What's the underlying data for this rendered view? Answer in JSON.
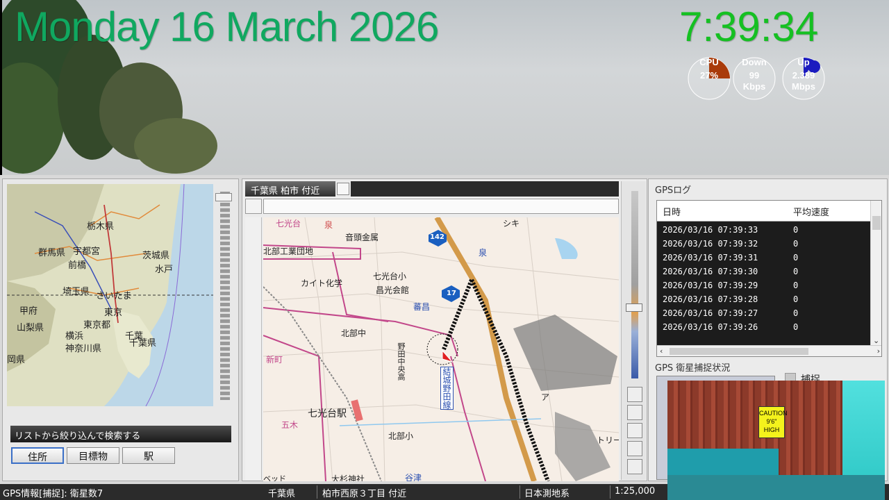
{
  "overlay": {
    "date": "Monday 16 March 2026",
    "time": "7:39:34",
    "gauges": [
      {
        "label": "CPU",
        "value": "27%",
        "unit": "",
        "percent": 27,
        "color": "#a93b0a"
      },
      {
        "label": "Down",
        "value": "99",
        "unit": "Kbps",
        "percent": 2,
        "color": "#2a44c4"
      },
      {
        "label": "Up",
        "value": "2.389",
        "unit": "Mbps",
        "percent": 8,
        "color": "#1b1bbf"
      }
    ]
  },
  "overview_map": {
    "labels": [
      "栃木県",
      "群馬県",
      "宇都宮",
      "前橋",
      "茨城県",
      "水戸",
      "埼玉県",
      "さいたま",
      "甲府",
      "東京",
      "山梨県",
      "東京都",
      "横浜",
      "千葉",
      "神奈川県",
      "千葉県",
      "岡県"
    ]
  },
  "search": {
    "header": "リストから絞り込んで検索する",
    "buttons": [
      "住所",
      "目標物",
      "駅"
    ]
  },
  "map": {
    "tab_title": "千葉県 柏市 付近",
    "labels": {
      "shichikoudai": "七光台",
      "izumi1": "泉",
      "onbo": "音頭金属",
      "hokubu_kogyo": "北部工業団地",
      "road142": "142",
      "izumi2": "泉",
      "kaito": "カイト化学",
      "shichiko_sho": "七光台小",
      "shoko": "昌光会館",
      "road17": "17",
      "banshou": "蕃昌",
      "line1": "野田線",
      "hokubu_chu": "北部中",
      "noda_chuo": "野田中央高",
      "kessen": "結城野田線",
      "shinmachi": "新町",
      "station": "七光台駅",
      "goboku": "五木",
      "hokubu_sho": "北部小",
      "yatsu": "谷津",
      "odaka": "大杉神社",
      "shiki": "シキ",
      "toritt": "トリー",
      "bed": "ベッド",
      "a": "ア"
    }
  },
  "gps_log": {
    "title": "GPSログ",
    "columns": [
      "日時",
      "平均速度"
    ],
    "rows": [
      {
        "time": "2026/03/16 07:39:33",
        "speed": "0"
      },
      {
        "time": "2026/03/16 07:39:32",
        "speed": "0"
      },
      {
        "time": "2026/03/16 07:39:31",
        "speed": "0"
      },
      {
        "time": "2026/03/16 07:39:30",
        "speed": "0"
      },
      {
        "time": "2026/03/16 07:39:29",
        "speed": "0"
      },
      {
        "time": "2026/03/16 07:39:28",
        "speed": "0"
      },
      {
        "time": "2026/03/16 07:39:27",
        "speed": "0"
      },
      {
        "time": "2026/03/16 07:39:26",
        "speed": "0"
      }
    ]
  },
  "satellite": {
    "title": "GPS 衛星捕捉状況",
    "capture_label": "捕捉"
  },
  "status": {
    "gps": "GPS情報[捕捉]: 衛星数7",
    "prefecture": "千葉県",
    "address": "柏市西原３丁目 付近",
    "datum": "日本測地系",
    "scale": "1:25,000"
  },
  "dashcam": {
    "sign_lines": [
      "CAUTION",
      "9'6\"",
      "HIGH"
    ]
  }
}
